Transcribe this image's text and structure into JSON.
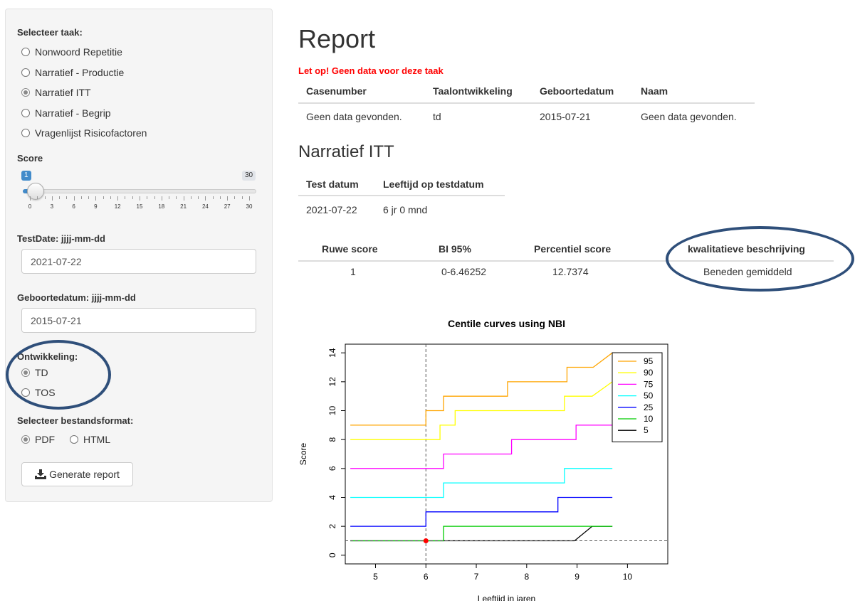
{
  "sidebar": {
    "task_label": "Selecteer taak:",
    "tasks": [
      {
        "label": "Nonwoord Repetitie",
        "selected": false
      },
      {
        "label": "Narratief - Productie",
        "selected": false
      },
      {
        "label": "Narratief ITT",
        "selected": true
      },
      {
        "label": "Narratief - Begrip",
        "selected": false
      },
      {
        "label": "Vragenlijst Risicofactoren",
        "selected": false
      }
    ],
    "score_label": "Score",
    "score_slider": {
      "value": "1",
      "max": "30",
      "ticks": [
        "0",
        "3",
        "6",
        "9",
        "12",
        "15",
        "18",
        "21",
        "24",
        "27",
        "30"
      ]
    },
    "testdate_label": "TestDate: jjjj-mm-dd",
    "testdate_value": "2021-07-22",
    "birthdate_label": "Geboortedatum: jjjj-mm-dd",
    "birthdate_value": "2015-07-21",
    "development_label": "Ontwikkeling:",
    "development_options": [
      {
        "label": "TD",
        "selected": true
      },
      {
        "label": "TOS",
        "selected": false
      }
    ],
    "format_label": "Selecteer bestandsformat:",
    "format_options": [
      {
        "label": "PDF",
        "selected": true
      },
      {
        "label": "HTML",
        "selected": false
      }
    ],
    "generate_button": "Generate report"
  },
  "report": {
    "title": "Report",
    "warning": "Let op! Geen data voor deze taak",
    "info_table": {
      "headers": [
        "Casenumber",
        "Taalontwikkeling",
        "Geboortedatum",
        "Naam"
      ],
      "row": [
        "Geen data gevonden.",
        "td",
        "2015-07-21",
        "Geen data gevonden."
      ]
    },
    "section_title": "Narratief ITT",
    "test_table": {
      "headers": [
        "Test datum",
        "Leeftijd op testdatum"
      ],
      "row": [
        "2021-07-22",
        "6 jr 0 mnd"
      ]
    },
    "score_table": {
      "headers": [
        "Ruwe score",
        "BI 95%",
        "Percentiel score",
        "kwalitatieve beschrijving"
      ],
      "row": [
        "1",
        "0-6.46252",
        "12.7374",
        "Beneden gemiddeld"
      ]
    }
  },
  "colors": {
    "warning": "#ff0000",
    "annotation_ellipse": "#2f4f7a",
    "slider_accent": "#428bca"
  },
  "chart_data": {
    "type": "line",
    "title": "Centile curves using NBI",
    "xlabel": "Leeftijd in jaren",
    "ylabel": "Score",
    "xlim": [
      4.4,
      10.8
    ],
    "ylim": [
      -0.6,
      14.6
    ],
    "xticks": [
      5,
      6,
      7,
      8,
      9,
      10
    ],
    "yticks": [
      0,
      2,
      4,
      6,
      8,
      10,
      12,
      14
    ],
    "legend_position": "top-right",
    "series": [
      {
        "name": "95",
        "color": "#ffa500",
        "points": [
          [
            4.5,
            9
          ],
          [
            6.0,
            9
          ],
          [
            6.0,
            10
          ],
          [
            6.35,
            10
          ],
          [
            6.35,
            11
          ],
          [
            6.62,
            11
          ],
          [
            6.62,
            11
          ],
          [
            7.62,
            11
          ],
          [
            7.62,
            12
          ],
          [
            8.8,
            12
          ],
          [
            8.8,
            13
          ],
          [
            9.32,
            13
          ],
          [
            9.32,
            13
          ],
          [
            9.7,
            14
          ]
        ]
      },
      {
        "name": "90",
        "color": "#ffff00",
        "points": [
          [
            4.5,
            8
          ],
          [
            6.28,
            8
          ],
          [
            6.28,
            9
          ],
          [
            6.58,
            9
          ],
          [
            6.58,
            10
          ],
          [
            7.62,
            10
          ],
          [
            7.62,
            10
          ],
          [
            8.75,
            10
          ],
          [
            8.75,
            11
          ],
          [
            9.3,
            11
          ],
          [
            9.3,
            11
          ],
          [
            9.7,
            12
          ]
        ]
      },
      {
        "name": "75",
        "color": "#ff00ff",
        "points": [
          [
            4.5,
            6
          ],
          [
            6.35,
            6
          ],
          [
            6.35,
            7
          ],
          [
            7.7,
            7
          ],
          [
            7.7,
            8
          ],
          [
            8.98,
            8
          ],
          [
            8.98,
            9
          ],
          [
            9.7,
            9
          ]
        ]
      },
      {
        "name": "50",
        "color": "#00ffff",
        "points": [
          [
            4.5,
            4
          ],
          [
            6.35,
            4
          ],
          [
            6.35,
            5
          ],
          [
            8.75,
            5
          ],
          [
            8.75,
            6
          ],
          [
            9.7,
            6
          ]
        ]
      },
      {
        "name": "25",
        "color": "#0000ff",
        "points": [
          [
            4.5,
            2
          ],
          [
            6.0,
            2
          ],
          [
            6.0,
            3
          ],
          [
            8.62,
            3
          ],
          [
            8.62,
            4
          ],
          [
            9.7,
            4
          ]
        ]
      },
      {
        "name": "10",
        "color": "#00cc00",
        "points": [
          [
            4.5,
            1
          ],
          [
            6.35,
            1
          ],
          [
            6.35,
            2
          ],
          [
            9.7,
            2
          ]
        ]
      },
      {
        "name": "5",
        "color": "#000000",
        "points": [
          [
            4.5,
            1
          ],
          [
            8.95,
            1
          ],
          [
            9.3,
            2
          ],
          [
            9.7,
            2
          ]
        ]
      }
    ],
    "reference_lines": {
      "x": 6.0,
      "y": 1
    },
    "marker": {
      "x": 6.0,
      "y": 1,
      "color": "#ff0000"
    }
  }
}
